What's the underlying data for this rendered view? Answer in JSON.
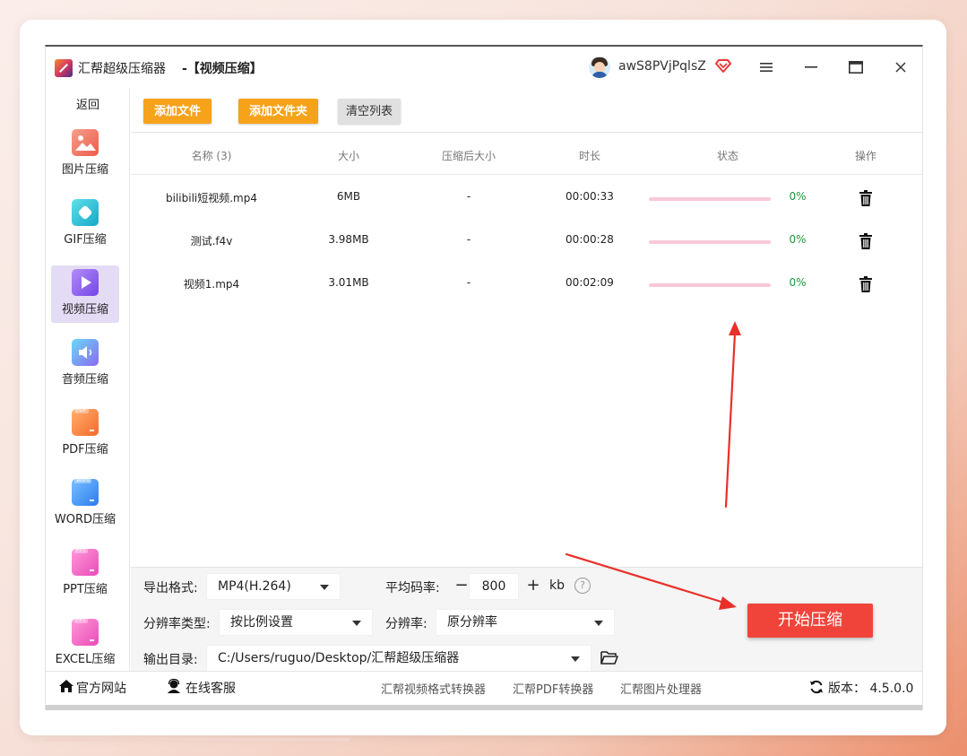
{
  "app": {
    "name": "汇帮超级压缩器",
    "mode": "-【视频压缩】",
    "username": "awS8PVjPqlsZ"
  },
  "sidebar": {
    "back_label": "返回",
    "items": [
      {
        "label": "图片压缩",
        "icon": "image-icon",
        "color": "#f2705a"
      },
      {
        "label": "GIF压缩",
        "icon": "gif-icon",
        "color": "#2fc4d8"
      },
      {
        "label": "视频压缩",
        "icon": "video-icon",
        "color": "#8a5df0"
      },
      {
        "label": "音频压缩",
        "icon": "audio-icon",
        "color": "#5ab8f0"
      },
      {
        "label": "PDF压缩",
        "icon": "pdf-icon",
        "color": "#f5823a"
      },
      {
        "label": "WORD压缩",
        "icon": "word-icon",
        "color": "#3a8ff0"
      },
      {
        "label": "PPT压缩",
        "icon": "ppt-icon",
        "color": "#f060c0"
      },
      {
        "label": "EXCEL压缩",
        "icon": "excel-icon",
        "color": "#f060c0"
      }
    ],
    "active_index": 2
  },
  "toolbar": {
    "add_file": "添加文件",
    "add_folder": "添加文件夹",
    "clear_list": "清空列表"
  },
  "table": {
    "headers": {
      "name": "名称 (3)",
      "size": "大小",
      "compressed_size": "压缩后大小",
      "duration": "时长",
      "status": "状态",
      "action": "操作"
    },
    "rows": [
      {
        "name": "bilibili短视频.mp4",
        "size": "6MB",
        "compressed": "-",
        "duration": "00:00:33",
        "progress": 0,
        "percent": "0%"
      },
      {
        "name": "测试.f4v",
        "size": "3.98MB",
        "compressed": "-",
        "duration": "00:00:28",
        "progress": 0,
        "percent": "0%"
      },
      {
        "name": "视频1.mp4",
        "size": "3.01MB",
        "compressed": "-",
        "duration": "00:02:09",
        "progress": 0,
        "percent": "0%"
      }
    ]
  },
  "settings": {
    "format_label": "导出格式:",
    "format_value": "MP4(H.264)",
    "bitrate_label": "平均码率:",
    "bitrate_value": "800",
    "bitrate_minus": "−",
    "bitrate_plus": "+",
    "bitrate_unit": "kb",
    "help": "?",
    "res_type_label": "分辨率类型:",
    "res_type_value": "按比例设置",
    "resolution_label": "分辨率:",
    "resolution_value": "原分辨率",
    "output_label": "输出目录:",
    "output_value": "C:/Users/ruguo/Desktop/汇帮超级压缩器",
    "start_button": "开始压缩"
  },
  "footer": {
    "website": "官方网站",
    "support": "在线客服",
    "link1": "汇帮视频格式转换器",
    "link2": "汇帮PDF转换器",
    "link3": "汇帮图片处理器",
    "version": "版本：  4.5.0.0"
  },
  "colors": {
    "accent_orange": "#f7a21b",
    "start_red": "#f0443a",
    "progress_track": "#f9c8d8",
    "percent_green": "#1a9a3a",
    "sidebar_active": "#e4dcf4"
  }
}
